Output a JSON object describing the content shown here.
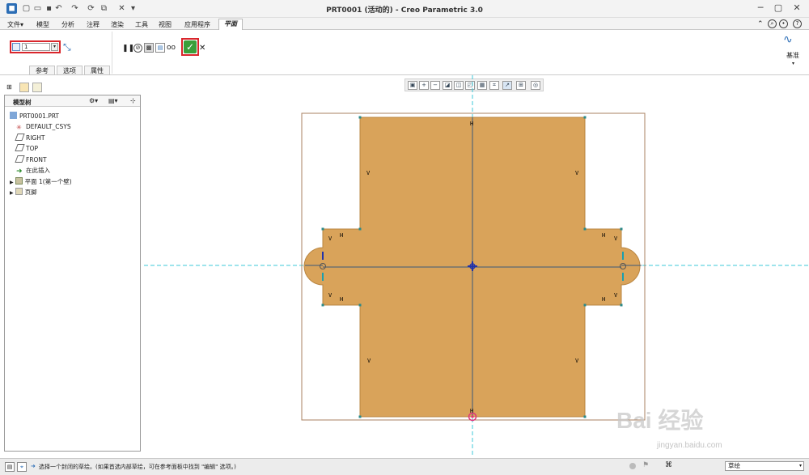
{
  "window": {
    "title": "PRT0001 (活动的) - Creo Parametric 3.0"
  },
  "quick_access": {
    "customize_label": "▾"
  },
  "ribbon_tabs": [
    "文件▾",
    "模型",
    "分析",
    "注释",
    "渲染",
    "工具",
    "视图",
    "应用程序",
    "平面"
  ],
  "active_tab_index": 8,
  "dashboard": {
    "thickness_value": "1",
    "ok_icon": "check-icon",
    "cancel_icon": "close-icon",
    "subtabs": [
      "参考",
      "选项",
      "属性"
    ]
  },
  "datum_group": {
    "label": "基准"
  },
  "model_tree": {
    "title": "模型树",
    "items": [
      {
        "label": "PRT0001.PRT",
        "icon": "part-icon",
        "indent": 0
      },
      {
        "label": "DEFAULT_CSYS",
        "icon": "csys-icon",
        "indent": 1
      },
      {
        "label": "RIGHT",
        "icon": "datum-plane-icon",
        "indent": 1
      },
      {
        "label": "TOP",
        "icon": "datum-plane-icon",
        "indent": 1
      },
      {
        "label": "FRONT",
        "icon": "datum-plane-icon",
        "indent": 1
      },
      {
        "label": "在此插入",
        "icon": "insert-arrow-icon",
        "indent": 1
      },
      {
        "label": "平面 1(第一个壁)",
        "icon": "wall-icon",
        "indent": 1,
        "expandable": true
      },
      {
        "label": "页脚",
        "icon": "footer-icon",
        "indent": 1,
        "expandable": true
      }
    ]
  },
  "sketch": {
    "constraint_labels": [
      "V",
      "V",
      "H",
      "V",
      "H",
      "V",
      "H",
      "V",
      "H",
      "V",
      "V",
      "V",
      "V",
      "H",
      "H",
      "V",
      "V"
    ]
  },
  "status": {
    "message": "选择一个封闭的草绘。(如果首选内部草绘，可在参考面板中找到 \"编辑\" 选项。)",
    "filter_value": "草绘"
  },
  "watermark": {
    "brand": "Bai 经验",
    "url": "jingyan.baidu.com"
  },
  "colors": {
    "part_fill": "#d9a35a",
    "accent_red": "#d9262c",
    "ok_green": "#3a9f3a",
    "datum_cyan": "#3cc8d8"
  }
}
